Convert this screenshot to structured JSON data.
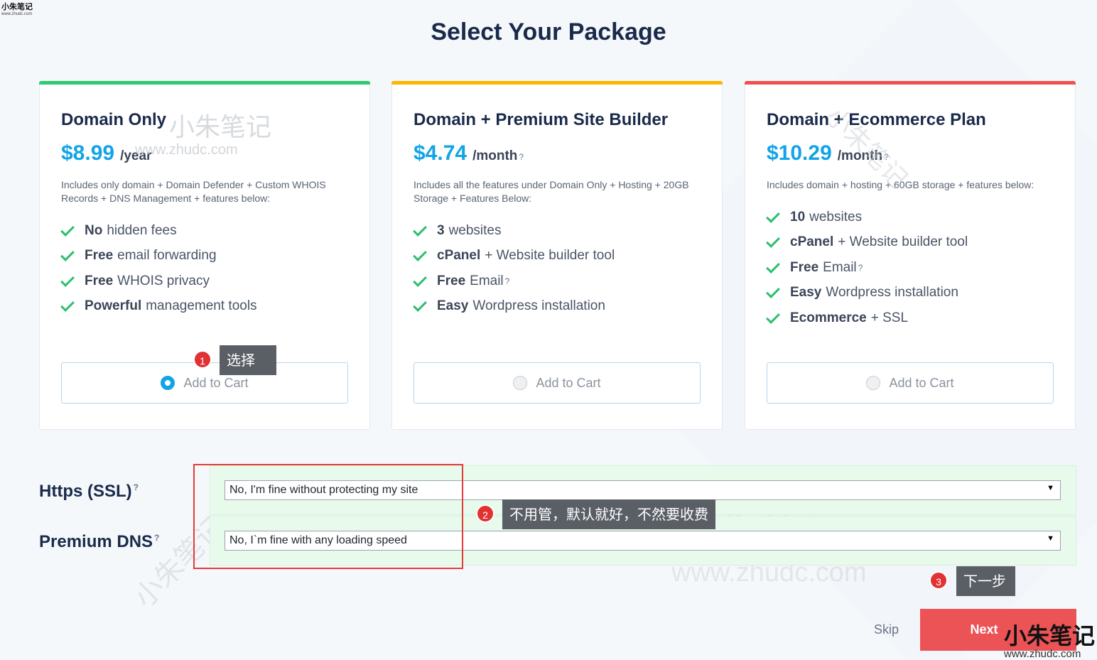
{
  "page": {
    "title": "Select Your Package"
  },
  "plans": [
    {
      "name": "Domain Only",
      "price": "$8.99",
      "unit": "/year",
      "unit_help": "",
      "description": "Includes only domain + Domain Defender + Custom WHOIS Records + DNS Management + features below:",
      "features": [
        {
          "bold": "No",
          "text": "hidden fees",
          "help": ""
        },
        {
          "bold": "Free",
          "text": "email forwarding",
          "help": ""
        },
        {
          "bold": "Free",
          "text": "WHOIS privacy",
          "help": ""
        },
        {
          "bold": "Powerful",
          "text": "management tools",
          "help": ""
        }
      ],
      "cart_label": "Add to Cart",
      "selected": true,
      "accent": "#2dcb70"
    },
    {
      "name": "Domain + Premium Site Builder",
      "price": "$4.74",
      "unit": "/month",
      "unit_help": "?",
      "description": "Includes all the features under Domain Only + Hosting + 20GB Storage + Features Below:",
      "features": [
        {
          "bold": "3",
          "text": "websites",
          "help": ""
        },
        {
          "bold": "cPanel",
          "text": "+ Website builder tool",
          "help": ""
        },
        {
          "bold": "Free",
          "text": "Email",
          "help": "?"
        },
        {
          "bold": "Easy",
          "text": "Wordpress installation",
          "help": ""
        }
      ],
      "cart_label": "Add to Cart",
      "selected": false,
      "accent": "#ffb400"
    },
    {
      "name": "Domain + Ecommerce Plan",
      "price": "$10.29",
      "unit": "/month",
      "unit_help": "?",
      "description": "Includes domain + hosting + 60GB storage + features below:",
      "features": [
        {
          "bold": "10",
          "text": "websites",
          "help": ""
        },
        {
          "bold": "cPanel",
          "text": "+ Website builder tool",
          "help": ""
        },
        {
          "bold": "Free",
          "text": "Email",
          "help": "?"
        },
        {
          "bold": "Easy",
          "text": "Wordpress installation",
          "help": ""
        },
        {
          "bold": "Ecommerce",
          "text": "+ SSL",
          "help": ""
        }
      ],
      "cart_label": "Add to Cart",
      "selected": false,
      "accent": "#f05050"
    }
  ],
  "addons": {
    "ssl": {
      "label": "Https (SSL)",
      "help": "?",
      "value": "No, I'm fine without protecting my site"
    },
    "dns": {
      "label": "Premium DNS",
      "help": "?",
      "value": "No, I`m fine with any loading speed"
    }
  },
  "annotations": {
    "step1": {
      "num": "1",
      "text": "选择"
    },
    "step2": {
      "num": "2",
      "text": "不用管，默认就好，不然要收费"
    },
    "step3": {
      "num": "3",
      "text": "下一步"
    }
  },
  "footer": {
    "skip": "Skip",
    "next": "Next"
  },
  "watermark": {
    "cn": "小朱笔记",
    "url": "www.zhudc.com"
  }
}
